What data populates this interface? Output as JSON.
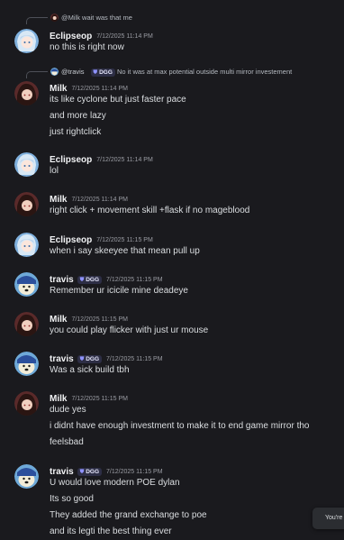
{
  "users": {
    "eclipseop": "Eclipseop",
    "milk": "Milk",
    "travis": "travis"
  },
  "tag_label": "DGG",
  "messages": [
    {
      "reply": {
        "name": "",
        "text": "@Milk wait was that me"
      },
      "author": "Eclipseop",
      "time": "7/12/2025 11:14 PM",
      "lines": [
        "no this is right now"
      ]
    },
    {
      "reply": {
        "name": "@travis",
        "tag": "DGG",
        "text": "No it was at max potential outside multi mirror investement"
      },
      "author": "Milk",
      "time": "7/12/2025 11:14 PM",
      "lines": [
        "its like cyclone but just faster pace",
        "and more lazy",
        "just rightclick"
      ]
    },
    {
      "author": "Eclipseop",
      "time": "7/12/2025 11:14 PM",
      "lines": [
        "lol"
      ]
    },
    {
      "author": "Milk",
      "time": "7/12/2025 11:14 PM",
      "lines": [
        "right click + movement skill +flask if no mageblood"
      ]
    },
    {
      "author": "Eclipseop",
      "time": "7/12/2025 11:15 PM",
      "lines": [
        "when i say skeeyee that mean pull up"
      ]
    },
    {
      "author": "travis",
      "tag": "DGG",
      "time": "7/12/2025 11:15 PM",
      "lines": [
        "Remember ur icicile mine deadeye"
      ]
    },
    {
      "author": "Milk",
      "time": "7/12/2025 11:15 PM",
      "lines": [
        "you could play flicker with just ur mouse"
      ]
    },
    {
      "author": "travis",
      "tag": "DGG",
      "time": "7/12/2025 11:15 PM",
      "lines": [
        "Was a sick build tbh"
      ]
    },
    {
      "author": "Milk",
      "time": "7/12/2025 11:15 PM",
      "lines": [
        "dude yes",
        "i didnt have enough investment to make it to end game mirror tho",
        "feelsbad"
      ]
    },
    {
      "author": "travis",
      "tag": "DGG",
      "time": "7/12/2025 11:15 PM",
      "lines": [
        "U would love modern POE dylan",
        "Its so good",
        "They added the grand exchange to poe",
        "and its legti the best thing ever"
      ]
    }
  ],
  "toast": {
    "text": "You're"
  }
}
